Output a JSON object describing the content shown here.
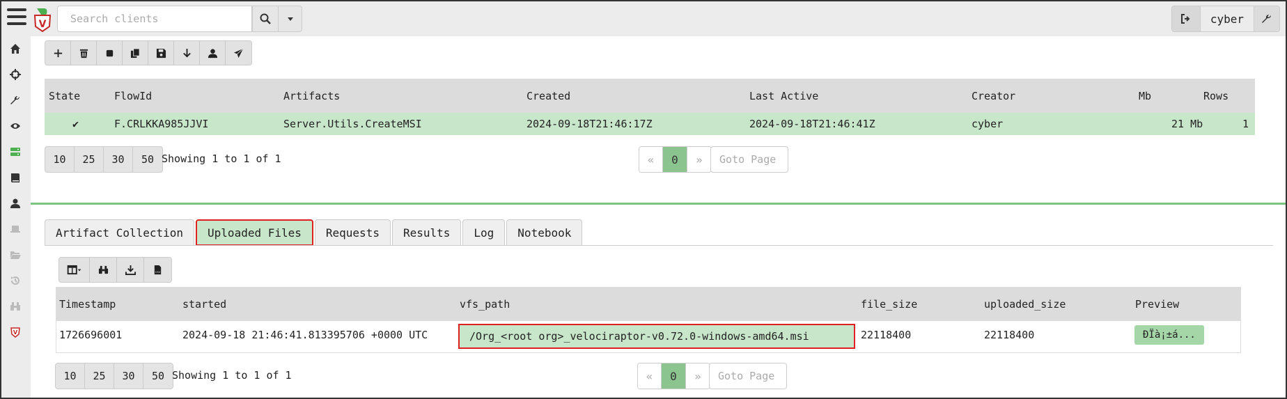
{
  "header": {
    "search_placeholder": "Search clients",
    "username": "cyber"
  },
  "icons": {
    "menu": "hamburger-icon",
    "search": "search-icon",
    "dropdown": "caret-down-icon",
    "logout": "sign-out-icon",
    "settings": "wrench-icon"
  },
  "sidebar": {
    "items": [
      {
        "icon": "home-icon",
        "active": false
      },
      {
        "icon": "crosshairs-icon",
        "active": false
      },
      {
        "icon": "wrench-icon",
        "active": false
      },
      {
        "icon": "eye-icon",
        "active": false
      },
      {
        "icon": "server-icon",
        "active": true
      },
      {
        "icon": "book-icon",
        "active": false
      },
      {
        "icon": "user-icon",
        "active": false
      },
      {
        "icon": "laptop-icon",
        "active": false
      },
      {
        "icon": "folder-open-icon",
        "active": false
      },
      {
        "icon": "history-icon",
        "active": false
      },
      {
        "icon": "binoculars-icon",
        "active": false
      },
      {
        "icon": "velociraptor-shield-icon",
        "active": false
      }
    ]
  },
  "flow_toolbar": [
    "plus-icon",
    "trash-icon",
    "stop-icon",
    "copy-icon",
    "save-icon",
    "download-icon",
    "user-icon",
    "paper-plane-icon"
  ],
  "flows_table": {
    "columns": [
      "State",
      "FlowId",
      "Artifacts",
      "Created",
      "Last Active",
      "Creator",
      "Mb",
      "Rows"
    ],
    "rows": [
      {
        "state": "✔",
        "flow_id": "F.CRLKKA985JJVI",
        "artifacts": "Server.Utils.CreateMSI",
        "created": "2024-09-18T21:46:17Z",
        "last_active": "2024-09-18T21:46:41Z",
        "creator": "cyber",
        "mb": "21 Mb",
        "rows": "1"
      }
    ]
  },
  "pagination_top": {
    "sizes": [
      "10",
      "25",
      "30",
      "50"
    ],
    "showing": "Showing 1 to 1 of 1",
    "prev": "«",
    "current": "0",
    "next": "»",
    "goto_placeholder": "Goto Page"
  },
  "tabs": [
    {
      "label": "Artifact Collection",
      "active": false
    },
    {
      "label": "Uploaded Files",
      "active": true
    },
    {
      "label": "Requests",
      "active": false
    },
    {
      "label": "Results",
      "active": false
    },
    {
      "label": "Log",
      "active": false
    },
    {
      "label": "Notebook",
      "active": false
    }
  ],
  "files_toolbar": [
    "columns-icon",
    "binoculars-icon",
    "download-icon",
    "csv-file-icon"
  ],
  "uploads_table": {
    "columns": [
      "Timestamp",
      "started",
      "vfs_path",
      "file_size",
      "uploaded_size",
      "Preview"
    ],
    "rows": [
      {
        "timestamp": "1726696001",
        "started": "2024-09-18 21:46:41.813395706 +0000 UTC",
        "vfs_path": "/Org_<root org>_velociraptor-v0.72.0-windows-amd64.msi",
        "file_size": "22118400",
        "uploaded_size": "22118400",
        "preview": "ÐÏà¡±á..."
      }
    ]
  },
  "pagination_bottom": {
    "sizes": [
      "10",
      "25",
      "30",
      "50"
    ],
    "showing": "Showing 1 to 1 of 1",
    "prev": "«",
    "current": "0",
    "next": "»",
    "goto_placeholder": "Goto Page"
  },
  "colors": {
    "accent_green": "#8bc48e",
    "selected_row": "#c8e6c9",
    "highlight_border": "#e02020",
    "divider": "#7cc47f"
  }
}
